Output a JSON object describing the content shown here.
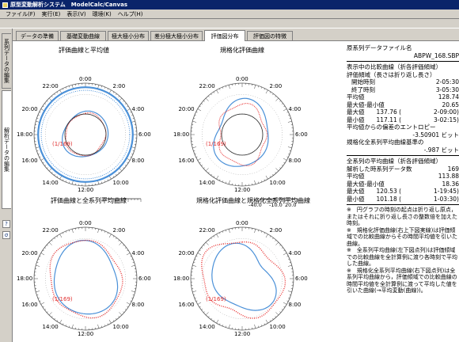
{
  "window": {
    "title": "原型変動解析システム　ModelCalc/Canvas"
  },
  "menu": [
    "ファイル(F)",
    "実行(E)",
    "表示(V)",
    "環境(K)",
    "ヘルプ(H)"
  ],
  "sidebar": {
    "tabs": [
      "系列データの編集",
      "解析データの編集"
    ],
    "icons": [
      "?",
      "σ"
    ]
  },
  "tabs": [
    {
      "label": "データの準備"
    },
    {
      "label": "基礎変動曲線"
    },
    {
      "label": "極大極小分布"
    },
    {
      "label": "差分極大極小分布"
    },
    {
      "label": "評価図分布"
    },
    {
      "label": "評価図の特徴"
    }
  ],
  "charts": [
    {
      "title": "評価曲線と平均値",
      "counter": "(1/169)"
    },
    {
      "title": "規格化評価曲線",
      "counter": "(1/169)"
    },
    {
      "title": "評価曲線と全系列平均曲線",
      "counter": "(1/169)"
    },
    {
      "title": "規格化評価曲線と規格化全系列平均曲線",
      "counter": "(1/169)"
    }
  ],
  "hour_labels": {
    "top": "0:00",
    "bottom": "12:00",
    "left": "18:00",
    "right": "6:00",
    "top_left": "22:00",
    "top_right": "2:00",
    "upper_left": "20:00",
    "upper_right": "4:00",
    "lower_left": "16:00",
    "lower_right": "8:00",
    "bottom_left": "14:00",
    "bottom_right": "10:00"
  },
  "axis_labels": {
    "min": "-40.0",
    "mid1": "-10.0",
    "mid2": "20.0"
  },
  "chart_colors": {
    "series": "#4a90d8",
    "mean": "#e83030",
    "ring": "#4a90d8"
  },
  "info": {
    "file_heading": "原系列データファイル名",
    "file_name": "ABPW_168.SBP",
    "compare_heading": "表示中の比較曲線（折各評価傾域）",
    "range_heading": "評価傾域（長さは折り返し長さ）",
    "rows": [
      {
        "label": "開始時刻",
        "value": "2-05:30",
        "indent": true
      },
      {
        "label": "終了時刻",
        "value": "3-05:30",
        "indent": true
      },
      {
        "label": "平均値",
        "value": "128.74",
        "indent": false
      },
      {
        "label": "最大値-最小値",
        "value": "20.65",
        "indent": false
      },
      {
        "label": "最大値　　137.76 (",
        "value": "2-09:00)",
        "indent": false
      },
      {
        "label": "最小値　　117.11 (",
        "value": "3-02:15)",
        "indent": false
      }
    ],
    "entropy_label": "平均値からの偏差のエントロピー",
    "entropy_value": "-3.50901 ビット",
    "norm_entropy_label": "規格化全系列平均曲線基準の",
    "norm_entropy_value": "-.987 ビット",
    "allmean_heading": "全系列の平均曲線（折各評価傾域）",
    "allmean_rows": [
      {
        "label": "解析した時系列データ数",
        "value": "169"
      },
      {
        "label": "平均値",
        "value": "113.88"
      },
      {
        "label": "最大値-最小値",
        "value": "18.36"
      },
      {
        "label": "最大値　　120.53 (",
        "value": "1-19:45)"
      },
      {
        "label": "最小値　　101.18 (",
        "value": "1-03:30)"
      }
    ],
    "notes": [
      "※　円グラフの時刻の起点は折り返し原点，またはそれに折り返し長さの整数倍を加えた時刻。",
      "※　規格化評価曲線(右上下図実線)は評価傾域での比較曲線からその時間平均値を引いた曲線。",
      "※　全系列平均曲線(左下図点列)は評価傾域での比較曲線を全計算例に渡り各時刻で平均した曲線。",
      "※　規格化全系列平均曲線(右下図点列)は全系列平均曲線から，評価傾域での比較曲線の時間平均値を全計算例に渡って平均した値を引いた曲線(→平均変動(曲線))。"
    ]
  }
}
